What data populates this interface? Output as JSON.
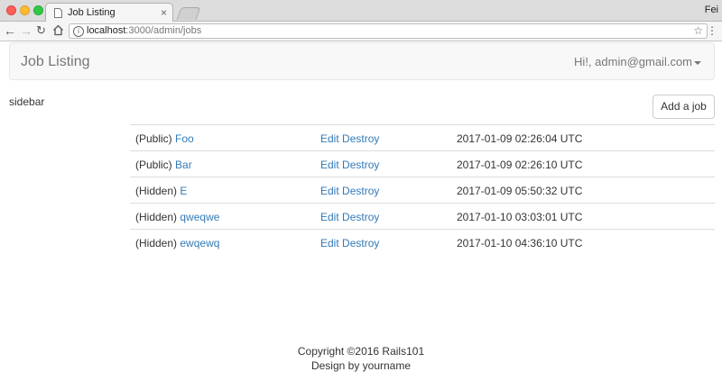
{
  "browser": {
    "tab_title": "Job Listing",
    "tab_close": "×",
    "profile_name": "Fei",
    "url_host": "localhost",
    "url_path": ":3000/admin/jobs",
    "icons": {
      "back": "arrow-left-icon",
      "forward": "arrow-right-icon",
      "reload": "reload-icon",
      "home": "home-icon",
      "info": "info-icon",
      "star": "star-icon",
      "menu": "kebab-menu-icon"
    }
  },
  "navbar": {
    "brand": "Job Listing",
    "user_label": "Hi!, admin@gmail.com"
  },
  "sidebar": {
    "label": "sidebar"
  },
  "actions": {
    "add_job": "Add a job"
  },
  "jobs": [
    {
      "visibility": "(Public)",
      "title": "Foo",
      "edit": "Edit",
      "destroy": "Destroy",
      "created_at": "2017-01-09 02:26:04 UTC"
    },
    {
      "visibility": "(Public)",
      "title": "Bar",
      "edit": "Edit",
      "destroy": "Destroy",
      "created_at": "2017-01-09 02:26:10 UTC"
    },
    {
      "visibility": "(Hidden)",
      "title": "E",
      "edit": "Edit",
      "destroy": "Destroy",
      "created_at": "2017-01-09 05:50:32 UTC"
    },
    {
      "visibility": "(Hidden)",
      "title": "qweqwe",
      "edit": "Edit",
      "destroy": "Destroy",
      "created_at": "2017-01-10 03:03:01 UTC"
    },
    {
      "visibility": "(Hidden)",
      "title": "ewqewq",
      "edit": "Edit",
      "destroy": "Destroy",
      "created_at": "2017-01-10 04:36:10 UTC"
    }
  ],
  "footer": {
    "copyright": "Copyright ©2016 Rails101",
    "design": "Design by yourname"
  },
  "colors": {
    "link": "#337ab7",
    "navbar_bg": "#f8f8f8",
    "navbar_text": "#777777"
  }
}
